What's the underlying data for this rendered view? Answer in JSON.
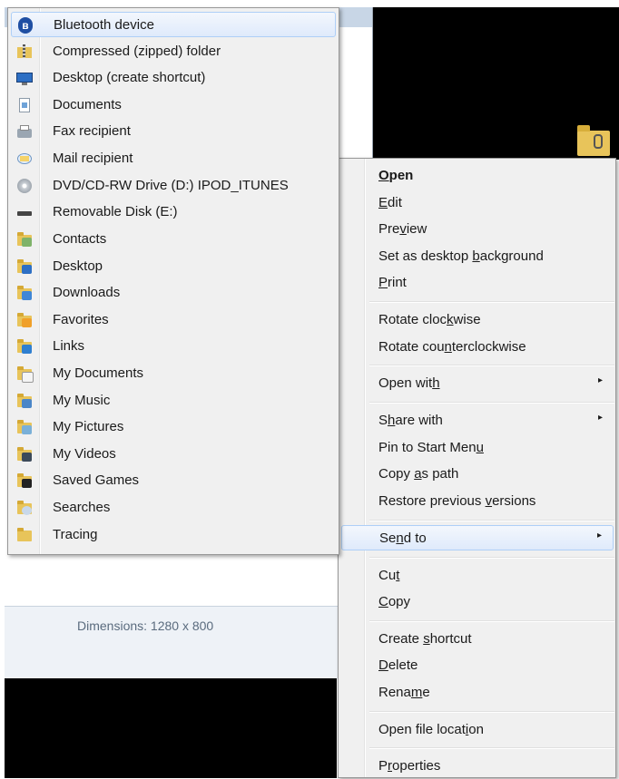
{
  "background": {
    "dimensions_label": "Dimensions: 1280 x 800"
  },
  "context_menu": {
    "items": [
      {
        "pre": "",
        "key": "O",
        "post": "pen"
      },
      {
        "pre": "",
        "key": "E",
        "post": "dit"
      },
      {
        "pre": "Pre",
        "key": "v",
        "post": "iew"
      },
      {
        "pre": "Set as desktop ",
        "key": "b",
        "post": "ackground"
      },
      {
        "pre": "",
        "key": "P",
        "post": "rint"
      },
      {
        "pre": "Rotate cloc",
        "key": "k",
        "post": "wise"
      },
      {
        "pre": "Rotate cou",
        "key": "n",
        "post": "terclockwise"
      },
      {
        "pre": "Open wit",
        "key": "h",
        "post": ""
      },
      {
        "pre": "S",
        "key": "h",
        "post": "are with"
      },
      {
        "pre": "Pin to Start Men",
        "key": "u",
        "post": ""
      },
      {
        "pre": "Copy ",
        "key": "a",
        "post": "s path"
      },
      {
        "pre": "Restore previous ",
        "key": "v",
        "post": "ersions"
      },
      {
        "pre": "Se",
        "key": "n",
        "post": "d to"
      },
      {
        "pre": "Cu",
        "key": "t",
        "post": ""
      },
      {
        "pre": "",
        "key": "C",
        "post": "opy"
      },
      {
        "pre": "Create ",
        "key": "s",
        "post": "hortcut"
      },
      {
        "pre": "",
        "key": "D",
        "post": "elete"
      },
      {
        "pre": "Rena",
        "key": "m",
        "post": "e"
      },
      {
        "pre": "Open file locat",
        "key": "i",
        "post": "on"
      },
      {
        "pre": "P",
        "key": "r",
        "post": "operties"
      }
    ],
    "submenu_arrow": "▸"
  },
  "send_to_menu": {
    "items": [
      {
        "label": "Bluetooth device",
        "icon": "bluetooth-icon"
      },
      {
        "label": "Compressed (zipped) folder",
        "icon": "zip-folder-icon"
      },
      {
        "label": "Desktop (create shortcut)",
        "icon": "desktop-icon"
      },
      {
        "label": "Documents",
        "icon": "document-icon"
      },
      {
        "label": "Fax recipient",
        "icon": "fax-icon"
      },
      {
        "label": "Mail recipient",
        "icon": "mail-icon"
      },
      {
        "label": "DVD/CD-RW Drive (D:) IPOD_ITUNES",
        "icon": "dvd-drive-icon"
      },
      {
        "label": "Removable Disk (E:)",
        "icon": "removable-disk-icon"
      },
      {
        "label": "Contacts",
        "icon": "contacts-folder-icon"
      },
      {
        "label": "Desktop",
        "icon": "desktop-folder-icon"
      },
      {
        "label": "Downloads",
        "icon": "downloads-folder-icon"
      },
      {
        "label": "Favorites",
        "icon": "favorites-folder-icon"
      },
      {
        "label": "Links",
        "icon": "links-folder-icon"
      },
      {
        "label": "My Documents",
        "icon": "my-documents-folder-icon"
      },
      {
        "label": "My Music",
        "icon": "my-music-folder-icon"
      },
      {
        "label": "My Pictures",
        "icon": "my-pictures-folder-icon"
      },
      {
        "label": "My Videos",
        "icon": "my-videos-folder-icon"
      },
      {
        "label": "Saved Games",
        "icon": "saved-games-folder-icon"
      },
      {
        "label": "Searches",
        "icon": "searches-folder-icon"
      },
      {
        "label": "Tracing",
        "icon": "tracing-folder-icon"
      }
    ]
  }
}
